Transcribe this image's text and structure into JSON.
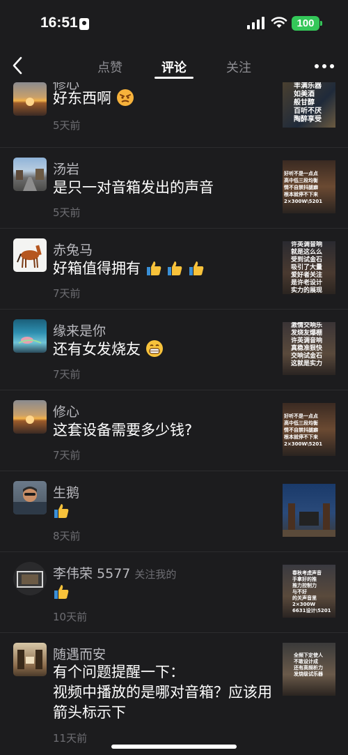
{
  "status_bar": {
    "time": "16:51",
    "battery": "100"
  },
  "nav": {
    "tabs": [
      {
        "label": "点赞"
      },
      {
        "label": "评论"
      },
      {
        "label": "关注"
      }
    ],
    "active_tab": "评论"
  },
  "comments": [
    {
      "name": "修心",
      "text": "好东西啊",
      "emoji": "face-emoji",
      "date": "5天前"
    },
    {
      "name": "汤岩",
      "text": "是只一对音箱发出的声音",
      "date": "5天前"
    },
    {
      "name": "赤兔马",
      "text": "好箱值得拥有",
      "emoji": "thumbs-up-x3",
      "date": "7天前"
    },
    {
      "name": "缘来是你",
      "text": "还有女发烧友",
      "emoji": "grin-emoji",
      "date": "7天前"
    },
    {
      "name": "修心",
      "text": "这套设备需要多少钱?",
      "date": "7天前"
    },
    {
      "name": "生鹅",
      "text": "",
      "emoji": "thumbs-up",
      "date": "8天前"
    },
    {
      "name": "李伟荣 5577",
      "follow_tag": "关注我的",
      "text": "",
      "emoji": "thumbs-up",
      "date": "10天前"
    },
    {
      "name": "随遇而安",
      "text": "有个问题提醒一下：\n视频中播放的是哪对音箱？应该用箭头标示下",
      "date": "11天前"
    }
  ],
  "thumbnails": [
    {
      "caption": "丰满乐器\n如美酒\n般甘醇\n百听不厌\n陶醉享受"
    },
    {
      "caption": "好听不是一点点\n高中低三段均衡\n情不自禁抖腿癖\n根本就停不下来\n2×300W\\5201"
    },
    {
      "caption": "许英调音响\n就是这么么\n受到试金石\n吸引了大量\n爱好者关注\n是许老设计\n实力的展现"
    },
    {
      "caption": "激情交响乐\n发烧友爆棚\n许英调音响\n真稳准狠快\n交响试金石\n这就是实力"
    },
    {
      "caption": "好听不是一点点\n高中低三段均衡\n情不自禁抖腿癖\n根本就停不下来\n2×300W\\5201"
    },
    {
      "caption": ""
    },
    {
      "caption": "春秋考虑声音\n手拿好的推\n推力控制力\n与不好\n的关声音里\n2×300W\n6631设计\\5201"
    },
    {
      "caption": "全频下定使人\n不敢设计成\n还有高频析力\n发烧级试乐器"
    }
  ],
  "colors": {
    "background": "#1c1c1e",
    "accent_green": "#34c759",
    "divider": "#2c2c2e"
  }
}
